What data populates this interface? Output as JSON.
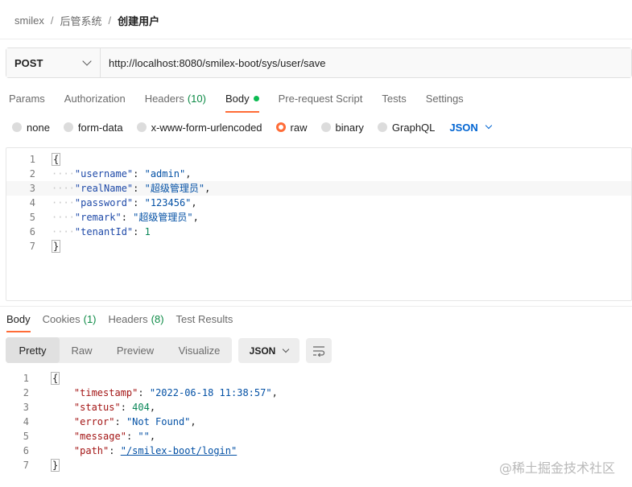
{
  "breadcrumb": {
    "items": [
      "smilex",
      "后管系统"
    ],
    "separator": "/",
    "current": "创建用户"
  },
  "request": {
    "method": "POST",
    "url": "http://localhost:8080/smilex-boot/sys/user/save"
  },
  "request_tabs": {
    "params": "Params",
    "authorization": "Authorization",
    "headers": "Headers",
    "headers_count": "(10)",
    "body": "Body",
    "prerequest": "Pre-request Script",
    "tests": "Tests",
    "settings": "Settings"
  },
  "body_types": {
    "none": "none",
    "form_data": "form-data",
    "urlencoded": "x-www-form-urlencoded",
    "raw": "raw",
    "binary": "binary",
    "graphql": "GraphQL",
    "selected": "raw",
    "language": "JSON"
  },
  "request_body": {
    "line_numbers": [
      "1",
      "2",
      "3",
      "4",
      "5",
      "6",
      "7"
    ],
    "open_brace": "{",
    "close_brace": "}",
    "fields": [
      {
        "key": "\"username\"",
        "value": "\"admin\"",
        "comma": ","
      },
      {
        "key": "\"realName\"",
        "value": "\"超级管理员\"",
        "comma": ","
      },
      {
        "key": "\"password\"",
        "value": "\"123456\"",
        "comma": ","
      },
      {
        "key": "\"remark\"",
        "value": "\"超级管理员\"",
        "comma": ","
      },
      {
        "key": "\"tenantId\"",
        "value": "1",
        "comma": ""
      }
    ]
  },
  "response_tabs": {
    "body": "Body",
    "cookies": "Cookies",
    "cookies_count": "(1)",
    "headers": "Headers",
    "headers_count": "(8)",
    "test_results": "Test Results"
  },
  "view_modes": {
    "pretty": "Pretty",
    "raw": "Raw",
    "preview": "Preview",
    "visualize": "Visualize",
    "language": "JSON"
  },
  "response_body": {
    "line_numbers": [
      "1",
      "2",
      "3",
      "4",
      "5",
      "6",
      "7"
    ],
    "open_brace": "{",
    "close_brace": "}",
    "fields": [
      {
        "key": "\"timestamp\"",
        "value": "\"2022-06-18 11:38:57\"",
        "comma": ","
      },
      {
        "key": "\"status\"",
        "value": "404",
        "comma": ","
      },
      {
        "key": "\"error\"",
        "value": "\"Not Found\"",
        "comma": ","
      },
      {
        "key": "\"message\"",
        "value": "\"\"",
        "comma": ","
      },
      {
        "key": "\"path\"",
        "value": "\"/smilex-boot/login\"",
        "comma": ""
      }
    ]
  },
  "watermark": "@稀土掘金技术社区",
  "colors": {
    "accent": "#ff6c37",
    "body_dot": "#0cbb52",
    "count_green": "#0c8a45",
    "json_blue": "#0265d2"
  }
}
